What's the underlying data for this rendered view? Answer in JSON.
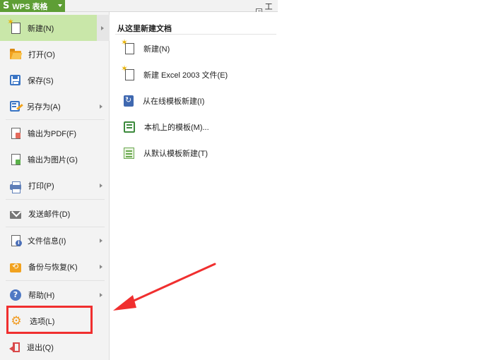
{
  "app": {
    "logo_glyph": "S",
    "title": "WPS 表格",
    "top_right_text": "工作"
  },
  "menu": {
    "items": [
      {
        "id": "new",
        "label": "新建(N)",
        "icon": "new-document-icon",
        "has_submenu": true,
        "active": true
      },
      {
        "id": "open",
        "label": "打开(O)",
        "icon": "open-folder-icon",
        "has_submenu": false
      },
      {
        "id": "save",
        "label": "保存(S)",
        "icon": "save-icon",
        "has_submenu": false
      },
      {
        "id": "saveas",
        "label": "另存为(A)",
        "icon": "save-as-icon",
        "has_submenu": true
      },
      {
        "id": "pdf",
        "label": "输出为PDF(F)",
        "icon": "pdf-document-icon",
        "has_submenu": false
      },
      {
        "id": "image",
        "label": "输出为图片(G)",
        "icon": "image-document-icon",
        "has_submenu": false
      },
      {
        "id": "print",
        "label": "打印(P)",
        "icon": "printer-icon",
        "has_submenu": true
      },
      {
        "id": "mail",
        "label": "发送邮件(D)",
        "icon": "mail-icon",
        "has_submenu": false
      },
      {
        "id": "info",
        "label": "文件信息(I)",
        "icon": "document-info-icon",
        "has_submenu": true
      },
      {
        "id": "backup",
        "label": "备份与恢复(K)",
        "icon": "backup-restore-icon",
        "has_submenu": true
      },
      {
        "id": "help",
        "label": "帮助(H)",
        "icon": "help-icon",
        "has_submenu": true
      },
      {
        "id": "options",
        "label": "选项(L)",
        "icon": "gear-icon",
        "has_submenu": false
      },
      {
        "id": "exit",
        "label": "退出(Q)",
        "icon": "exit-icon",
        "has_submenu": false
      }
    ]
  },
  "submenu": {
    "title": "从这里新建文档",
    "items": [
      {
        "label": "新建(N)",
        "icon": "new-document-icon"
      },
      {
        "label": "新建 Excel 2003 文件(E)",
        "icon": "new-excel2003-icon"
      },
      {
        "label": "从在线模板新建(I)",
        "icon": "online-template-icon"
      },
      {
        "label": "本机上的模板(M)...",
        "icon": "local-template-icon"
      },
      {
        "label": "从默认模板新建(T)",
        "icon": "default-template-icon"
      }
    ]
  },
  "help_glyph": "?",
  "gear_glyph": "⚙",
  "colors": {
    "brand_green": "#5e9e35",
    "active_item": "#c9e7a9",
    "annotation_red": "#f02f2f"
  }
}
